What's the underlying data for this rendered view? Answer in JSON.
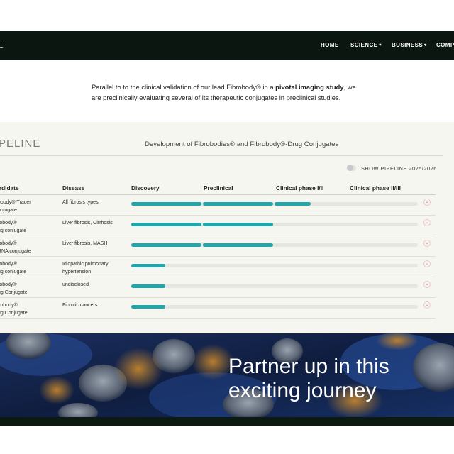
{
  "nav": {
    "logo_fragment": "E",
    "items": [
      {
        "label": "HOME",
        "has_caret": false
      },
      {
        "label": "SCIENCE",
        "has_caret": true
      },
      {
        "label": "BUSINESS",
        "has_caret": true
      },
      {
        "label": "COMPA",
        "has_caret": false
      }
    ]
  },
  "intro": {
    "line1_pre": "Parallel to to the clinical validation of our lead Fibrobody® in a ",
    "line1_bold": "pivotal imaging study",
    "line1_post": ", we",
    "line2": "are preclinically evaluating several of its therapeutic conjugates in preclinical studies."
  },
  "pipeline": {
    "title": "PELINE",
    "subtitle": "Development of Fibrobodies® and Fibrobody®-Drug Conjugates",
    "toggle_label": "SHOW PIPELINE 2025/2026",
    "columns": [
      "ndidate",
      "Disease",
      "Discovery",
      "Preclinical",
      "Clinical phase I/II",
      "Clinical phase II/III"
    ],
    "rows": [
      {
        "candidate": [
          "obody®-Tracer",
          "onjugate"
        ],
        "disease": [
          "All fibrosis types"
        ],
        "progress": 0.625
      },
      {
        "candidate": [
          "robody®",
          "ug conjugate"
        ],
        "disease": [
          "Liver fibrosis, Cirrhosis"
        ],
        "progress": 0.5
      },
      {
        "candidate": [
          "robody®",
          "RNA conjugate"
        ],
        "disease": [
          "Liver fibrosis, MASH"
        ],
        "progress": 0.5
      },
      {
        "candidate": [
          "robody®",
          "ug conjugate"
        ],
        "disease": [
          "Idiopathic pulmonary",
          "hypertension"
        ],
        "progress": 0.12
      },
      {
        "candidate": [
          "robody®",
          "ug Conjugate"
        ],
        "disease": [
          "undisclosed"
        ],
        "progress": 0.12
      },
      {
        "candidate": [
          "cobody®",
          "ug Conjugate"
        ],
        "disease": [
          "Fibrotic cancers"
        ],
        "progress": 0.12
      }
    ],
    "accent_color": "#20a6ab"
  },
  "hero": {
    "line1": "Partner up in this",
    "line2": "exciting journey"
  }
}
